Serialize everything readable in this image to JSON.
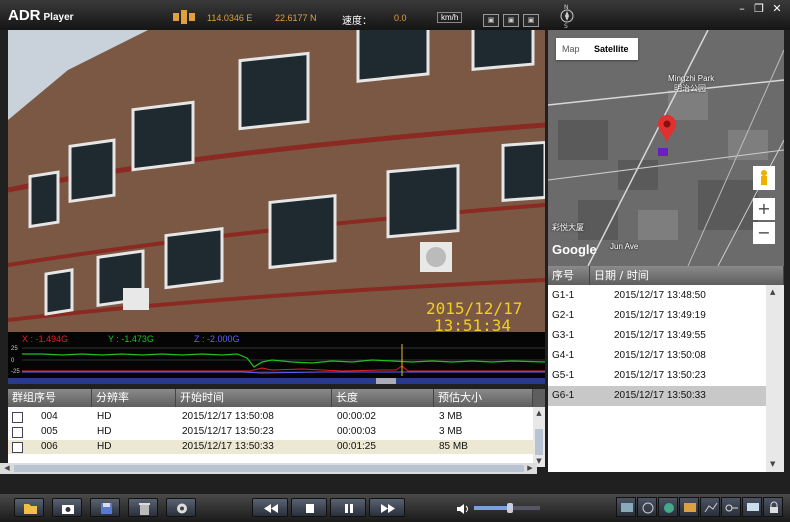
{
  "app": {
    "title": "ADR",
    "subtitle": "Player"
  },
  "gps": {
    "longitude": "114.0346 E",
    "latitude": "22.6177 N",
    "speed_label": "速度：",
    "speed_value": "0.0",
    "speed_unit": "km/h"
  },
  "window_controls": {
    "minimize": "–",
    "restore": "❐",
    "close": "✕"
  },
  "video": {
    "date": "2015/12/17",
    "time": "13:51:34"
  },
  "sensor": {
    "x_label": "X : -1.494G",
    "y_label": "Y : -1.473G",
    "z_label": "Z : -2.000G",
    "scale": [
      "25",
      "0",
      "-25"
    ],
    "colors": {
      "x": "#e02020",
      "y": "#20c020",
      "z": "#6060ff"
    }
  },
  "events": {
    "headers": [
      "群组序号",
      "分辨率",
      "开始时间",
      "长度",
      "预估大小"
    ],
    "rows": [
      {
        "id": "004",
        "res": "HD",
        "start": "2015/12/17 13:50:08",
        "len": "00:00:02",
        "size": "3 MB"
      },
      {
        "id": "005",
        "res": "HD",
        "start": "2015/12/17 13:50:23",
        "len": "00:00:03",
        "size": "3 MB"
      },
      {
        "id": "006",
        "res": "HD",
        "start": "2015/12/17 13:50:33",
        "len": "00:01:25",
        "size": "85 MB"
      }
    ]
  },
  "map": {
    "tab_map": "Map",
    "tab_satellite": "Satellite",
    "park_en": "Mingzhi Park",
    "park_cn": "明治公园",
    "place": "彩悦大厦",
    "road": "Jun Ave",
    "logo": "Google"
  },
  "files": {
    "headers": [
      "序号",
      "日期 / 时间"
    ],
    "rows": [
      {
        "id": "G1-1",
        "dt": "2015/12/17  13:48:50"
      },
      {
        "id": "G2-1",
        "dt": "2015/12/17  13:49:19"
      },
      {
        "id": "G3-1",
        "dt": "2015/12/17  13:49:55"
      },
      {
        "id": "G4-1",
        "dt": "2015/12/17  13:50:08"
      },
      {
        "id": "G5-1",
        "dt": "2015/12/17  13:50:23"
      },
      {
        "id": "G6-1",
        "dt": "2015/12/17  13:50:33"
      }
    ],
    "selected_index": 5
  },
  "toolbar": {
    "left": [
      "folder-icon",
      "camera-icon",
      "save-icon",
      "delete-icon",
      "settings-icon"
    ],
    "playback": [
      "rewind-icon",
      "stop-icon",
      "pause-icon",
      "fast-forward-icon"
    ],
    "volume_level": 0.55,
    "right": [
      "map-icon",
      "network-icon",
      "globe-icon",
      "image-icon",
      "chart-icon",
      "key-icon",
      "monitor-icon",
      "lock-icon"
    ]
  }
}
